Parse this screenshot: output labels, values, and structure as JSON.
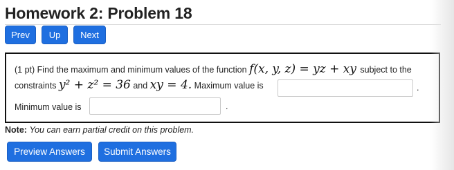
{
  "page_title": "Homework 2: Problem 18",
  "nav": {
    "prev_label": "Prev",
    "up_label": "Up",
    "next_label": "Next"
  },
  "problem": {
    "points": "(1 pt)",
    "intro": "Find the maximum and minimum values of the function",
    "function_math": "f(x, y, z) = yz + xy",
    "subject_to": "subject to the",
    "constraints_label": "constraints",
    "constraint_1": "y² + z² = 36",
    "and_word": "and",
    "constraint_2": "xy = 4.",
    "max_label": "Maximum value is",
    "max_value": "",
    "min_label": "Minimum value is",
    "min_value": "",
    "period": "."
  },
  "note": {
    "label": "Note:",
    "text": "You can earn partial credit on this problem."
  },
  "actions": {
    "preview_label": "Preview Answers",
    "submit_label": "Submit Answers"
  },
  "colors": {
    "button_blue": "#1f6fe0",
    "box_border": "#111111"
  }
}
